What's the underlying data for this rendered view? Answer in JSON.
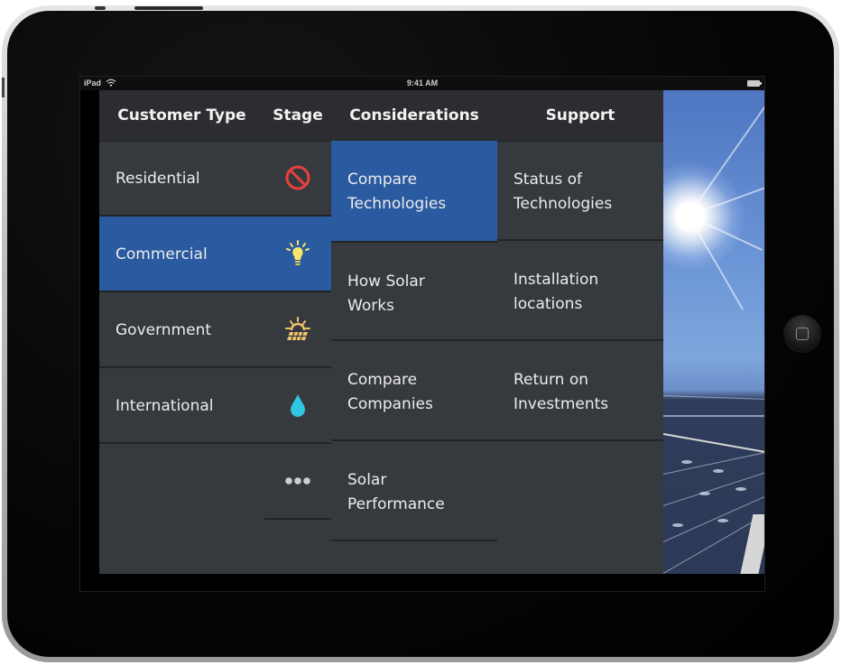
{
  "status_bar": {
    "carrier": "iPad",
    "wifi_icon": "wifi-icon",
    "time": "9:41 AM",
    "battery_icon": "battery-full-icon"
  },
  "header": {
    "columns": [
      "Customer Type",
      "Stage",
      "Considerations",
      "Support"
    ]
  },
  "customer_types": [
    {
      "label": "Residential",
      "selected": false
    },
    {
      "label": "Commercial",
      "selected": true
    },
    {
      "label": "Government",
      "selected": false
    },
    {
      "label": "International",
      "selected": false
    }
  ],
  "stages": [
    {
      "icon": "no-entry-icon",
      "color": "#e8403c"
    },
    {
      "icon": "lightbulb-icon",
      "color": "#f7e46a"
    },
    {
      "icon": "sunrise-solar-panel-icon",
      "color": "#f2c66b"
    },
    {
      "icon": "water-drop-icon",
      "color": "#2ec6e0"
    },
    {
      "icon": "more-dots-icon",
      "color": "#cfcfcf"
    }
  ],
  "considerations": [
    {
      "line1": "Compare",
      "line2": "Technologies",
      "selected": true
    },
    {
      "line1": "How Solar",
      "line2": "Works",
      "selected": false
    },
    {
      "line1": "Compare",
      "line2": "Companies",
      "selected": false
    },
    {
      "line1": "Solar",
      "line2": "Performance",
      "selected": false
    }
  ],
  "support": [
    {
      "line1": "Status of",
      "line2": "Technologies"
    },
    {
      "line1": "Installation",
      "line2": "locations"
    },
    {
      "line1": "Return on",
      "line2": "Investments"
    }
  ],
  "colors": {
    "selected": "#2a5aa0",
    "panel": "#36393e",
    "header": "#2b2d31"
  }
}
